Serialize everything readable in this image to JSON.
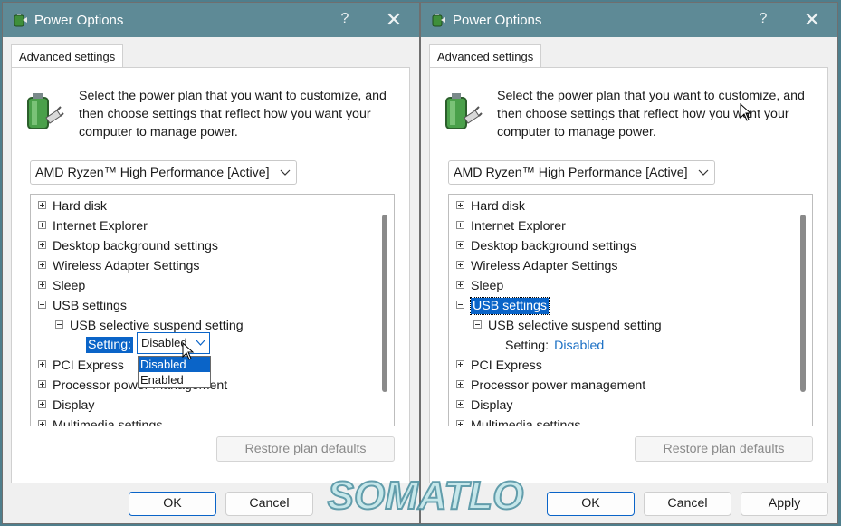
{
  "windows": [
    {
      "title": "Power Options",
      "help": "?",
      "close": "✕",
      "tab": "Advanced settings",
      "intro": "Select the power plan that you want to customize, and then choose settings that reflect how you want your computer to manage power.",
      "plan": "AMD Ryzen™ High Performance [Active]",
      "tree": [
        "Hard disk",
        "Internet Explorer",
        "Desktop background settings",
        "Wireless Adapter Settings",
        "Sleep",
        "USB settings",
        "USB selective suspend setting",
        "Setting:",
        "PCI Express",
        "Processor power management",
        "Display",
        "Multimedia settings"
      ],
      "setting_value": "Disabled",
      "dropdown_options": [
        "Disabled",
        "Enabled"
      ],
      "restore": "Restore plan defaults",
      "ok": "OK",
      "cancel": "Cancel"
    },
    {
      "title": "Power Options",
      "help": "?",
      "close": "✕",
      "tab": "Advanced settings",
      "intro": "Select the power plan that you want to customize, and then choose settings that reflect how you want your computer to manage power.",
      "plan": "AMD Ryzen™ High Performance [Active]",
      "tree": [
        "Hard disk",
        "Internet Explorer",
        "Desktop background settings",
        "Wireless Adapter Settings",
        "Sleep",
        "USB settings",
        "USB selective suspend setting",
        "Setting:",
        "PCI Express",
        "Processor power management",
        "Display",
        "Multimedia settings"
      ],
      "setting_value": "Disabled",
      "restore": "Restore plan defaults",
      "ok": "OK",
      "cancel": "Cancel",
      "apply": "Apply"
    }
  ],
  "watermark": "SOMATLO",
  "colors": {
    "titlebar": "#5e8a96",
    "selection": "#0a64c8",
    "link": "#1a6fc4"
  }
}
